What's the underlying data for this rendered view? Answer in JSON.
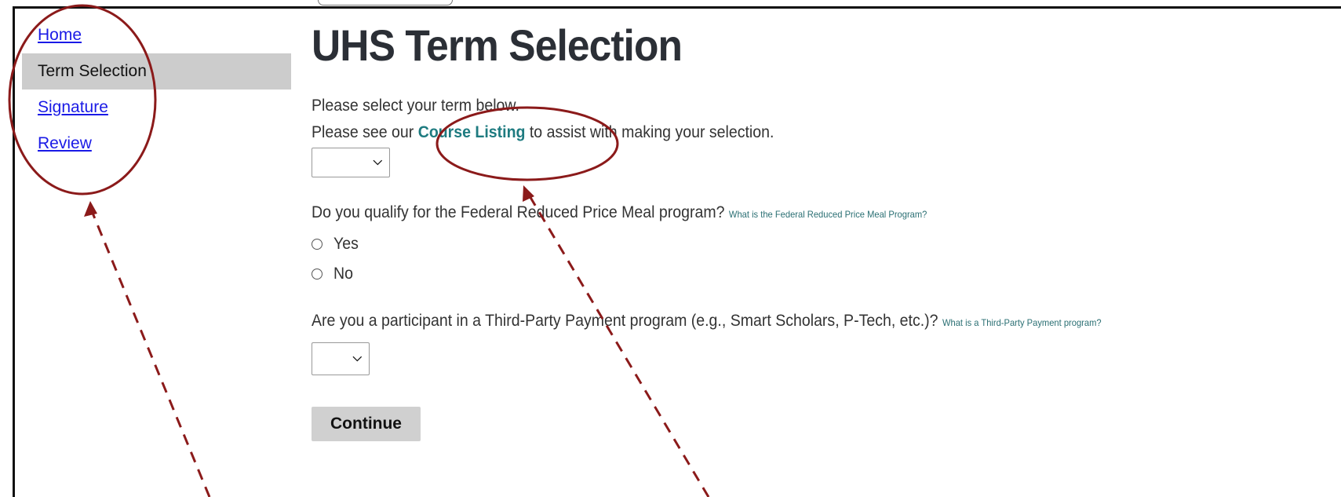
{
  "sidebar": {
    "items": [
      {
        "label": "Home",
        "active": false
      },
      {
        "label": "Term Selection",
        "active": true
      },
      {
        "label": "Signature",
        "active": false
      },
      {
        "label": "Review",
        "active": false
      }
    ]
  },
  "main": {
    "title": "UHS Term Selection",
    "intro_line1": "Please select your term below.",
    "intro_line2_prefix": "Please see our ",
    "course_listing_link": "Course Listing",
    "intro_line2_suffix": " to assist with making your selection.",
    "term_select_value": "",
    "meal_question": "Do you qualify for the Federal Reduced Price Meal program?",
    "meal_help_link": "What is the Federal Reduced Price Meal Program?",
    "meal_options": [
      "Yes",
      "No"
    ],
    "third_party_question": "Are you a participant in a Third-Party Payment program (e.g., Smart Scholars, P-Tech, etc.)?",
    "third_party_help_link": "What is a Third-Party Payment program?",
    "third_party_select_value": "",
    "continue_label": "Continue"
  },
  "colors": {
    "annotation": "#8b1a1a",
    "link_blue": "#1a1ae6",
    "link_teal": "#1e7b80",
    "active_nav_bg": "#cccccc"
  }
}
